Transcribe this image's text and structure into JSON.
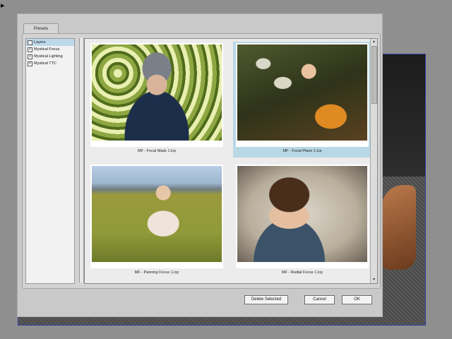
{
  "dialog": {
    "tab_label": "Presets",
    "tree": [
      {
        "label": "Layers",
        "state": "-",
        "selected": true
      },
      {
        "label": "Mystical Focus",
        "state": "+"
      },
      {
        "label": "Mystical Lighting",
        "state": "+"
      },
      {
        "label": "Mystical TTC",
        "state": "+"
      }
    ],
    "presets": [
      {
        "caption": "MF - Focal Mask 1.lcp",
        "selected": false
      },
      {
        "caption": "MF - Focal Plane 1.lcp",
        "selected": true
      },
      {
        "caption": "MF - Panning Focus 1.lcp",
        "selected": false
      },
      {
        "caption": "MF - Radial Focus 1.lcp",
        "selected": false
      }
    ],
    "buttons": {
      "delete": "Delete Selected",
      "cancel": "Cancel",
      "ok": "OK"
    }
  },
  "colors": {
    "selection": "#b8d8e6",
    "dialog_bg": "#c9c9c9"
  }
}
